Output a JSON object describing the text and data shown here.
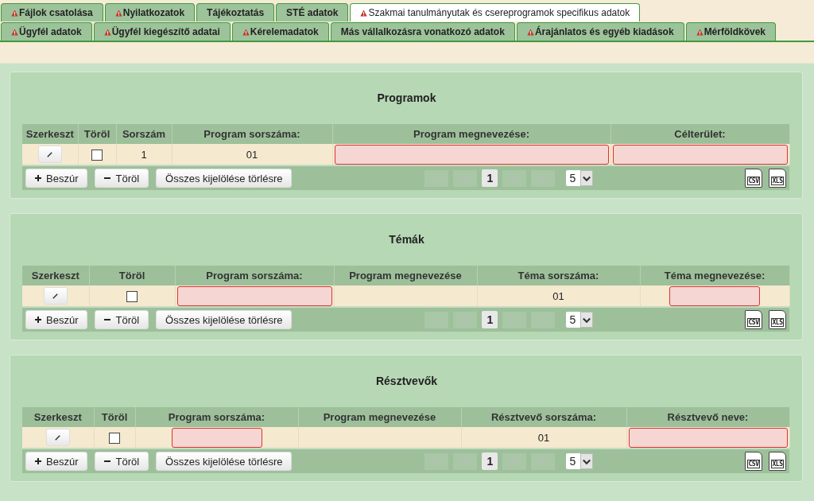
{
  "tab_rows": [
    [
      {
        "label": "Fájlok csatolása",
        "warning": true,
        "selected": false
      },
      {
        "label": "Nyilatkozatok",
        "warning": true,
        "selected": false
      },
      {
        "label": "Tájékoztatás",
        "warning": false,
        "selected": false
      },
      {
        "label": "STÉ adatok",
        "warning": false,
        "selected": false
      },
      {
        "label": "Szakmai tanulmányutak és csereprogramok specifikus adatok",
        "warning": true,
        "selected": true
      }
    ],
    [
      {
        "label": "Ügyfél adatok",
        "warning": true,
        "selected": false
      },
      {
        "label": "Ügyfél kiegészítő adatai",
        "warning": true,
        "selected": false
      },
      {
        "label": "Kérelemadatok",
        "warning": true,
        "selected": false
      },
      {
        "label": "Más vállalkozásra vonatkozó adatok",
        "warning": false,
        "selected": false
      },
      {
        "label": "Árajánlatos és egyéb kiadások",
        "warning": true,
        "selected": false
      },
      {
        "label": "Mérföldkövek",
        "warning": true,
        "selected": false
      }
    ]
  ],
  "sections": [
    {
      "title": "Programok",
      "columns": [
        "Szerkeszt",
        "Töröl",
        "Sorszám",
        "Program sorszáma:",
        "Program megnevezése:",
        "Célterület:"
      ],
      "rows": [
        [
          {
            "kind": "edit"
          },
          {
            "kind": "checkbox",
            "checked": false
          },
          {
            "kind": "text",
            "value": "1"
          },
          {
            "kind": "text",
            "value": "01"
          },
          {
            "kind": "input",
            "invalid": true
          },
          {
            "kind": "input",
            "invalid": true
          }
        ]
      ],
      "buttons": [
        {
          "kind": "add",
          "label": "Beszúr"
        },
        {
          "kind": "remove",
          "label": "Töröl"
        },
        {
          "kind": "plain",
          "label": "Összes kijelölése törlésre"
        }
      ],
      "page": "1",
      "page_size": "5",
      "exports": [
        "CSV",
        "XLS"
      ]
    },
    {
      "title": "Témák",
      "columns": [
        "Szerkeszt",
        "Töröl",
        "Program sorszáma:",
        "Program megnevezése",
        "Téma sorszáma:",
        "Téma megnevezése:"
      ],
      "rows": [
        [
          {
            "kind": "edit"
          },
          {
            "kind": "checkbox",
            "checked": false
          },
          {
            "kind": "input",
            "invalid": true
          },
          {
            "kind": "empty"
          },
          {
            "kind": "text",
            "value": "01"
          },
          {
            "kind": "input",
            "invalid": true
          }
        ]
      ],
      "buttons": [
        {
          "kind": "add",
          "label": "Beszúr"
        },
        {
          "kind": "remove",
          "label": "Töröl"
        },
        {
          "kind": "plain",
          "label": "Összes kijelölése törlésre"
        }
      ],
      "page": "1",
      "page_size": "5",
      "exports": [
        "CSV",
        "XLS"
      ]
    },
    {
      "title": "Résztvevők",
      "columns": [
        "Szerkeszt",
        "Töröl",
        "Program sorszáma:",
        "Program megnevezése",
        "Résztvevő sorszáma:",
        "Résztvevő neve:"
      ],
      "rows": [
        [
          {
            "kind": "edit"
          },
          {
            "kind": "checkbox",
            "checked": false
          },
          {
            "kind": "input",
            "invalid": true
          },
          {
            "kind": "empty"
          },
          {
            "kind": "text",
            "value": "01"
          },
          {
            "kind": "input",
            "invalid": true
          }
        ]
      ],
      "buttons": [
        {
          "kind": "add",
          "label": "Beszúr"
        },
        {
          "kind": "remove",
          "label": "Töröl"
        },
        {
          "kind": "plain",
          "label": "Összes kijelölése törlésre"
        }
      ],
      "page": "1",
      "page_size": "5",
      "exports": [
        "CSV",
        "XLS"
      ]
    }
  ]
}
